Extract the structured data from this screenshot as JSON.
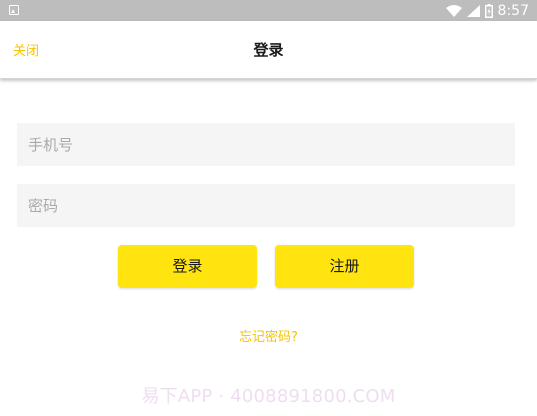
{
  "status_bar": {
    "time": "8:57",
    "icons": [
      "app-notification-icon",
      "wifi-icon",
      "signal-icon",
      "battery-icon"
    ]
  },
  "header": {
    "close_label": "关闭",
    "title": "登录"
  },
  "form": {
    "phone_placeholder": "手机号",
    "password_placeholder": "密码",
    "login_label": "登录",
    "register_label": "注册",
    "forgot_label": "忘记密码?"
  },
  "watermark": "易下APP · 4008891800.COM",
  "colors": {
    "accent": "#ffe40f",
    "link": "#f5c400",
    "input_bg": "#f5f5f5",
    "status_bar": "#bdbdbd"
  }
}
